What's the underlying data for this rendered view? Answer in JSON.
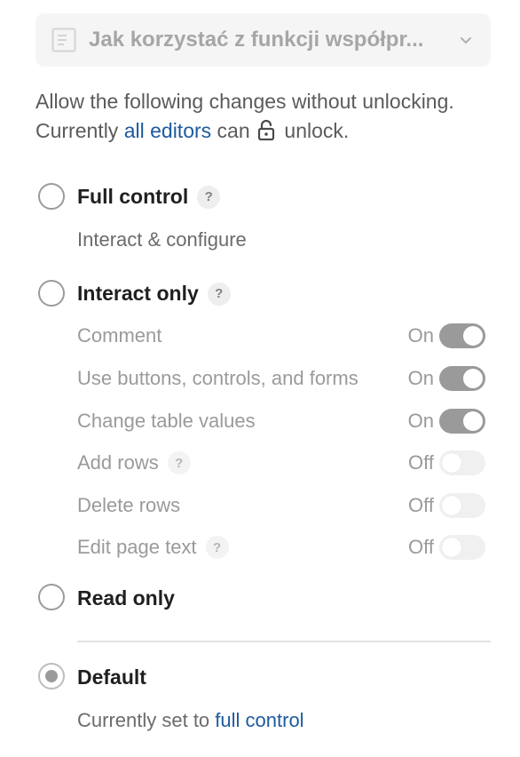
{
  "page_select": {
    "title": "Jak korzystać z funkcji współpr...",
    "icon": "document-icon",
    "chevron": "chevron-down-icon"
  },
  "intro": {
    "text1": "Allow the following changes without unlocking. Currently",
    "editors_link": "all editors",
    "text2": "can",
    "lock_icon": "lock-open-icon",
    "text3": "unlock."
  },
  "options": {
    "full_control": {
      "label": "Full control",
      "help": "?",
      "description": "Interact & configure",
      "selected": false
    },
    "interact_only": {
      "label": "Interact only",
      "help": "?",
      "selected": false
    },
    "read_only": {
      "label": "Read only",
      "selected": false
    },
    "default": {
      "label": "Default",
      "description_prefix": "Currently set to",
      "description_link": "full control",
      "selected": true
    }
  },
  "permissions": [
    {
      "label": "Comment",
      "state": "On",
      "on": true,
      "help": ""
    },
    {
      "label": "Use buttons, controls, and forms",
      "state": "On",
      "on": true,
      "help": ""
    },
    {
      "label": "Change table values",
      "state": "On",
      "on": true,
      "help": ""
    },
    {
      "label": "Add rows",
      "state": "Off",
      "on": false,
      "help": "?"
    },
    {
      "label": "Delete rows",
      "state": "Off",
      "on": false,
      "help": ""
    },
    {
      "label": "Edit page text",
      "state": "Off",
      "on": false,
      "help": "?"
    }
  ],
  "colors": {
    "link": "#1d5a9e",
    "toggle_on": "#9a9a9a",
    "toggle_off": "#f0f0f0"
  }
}
